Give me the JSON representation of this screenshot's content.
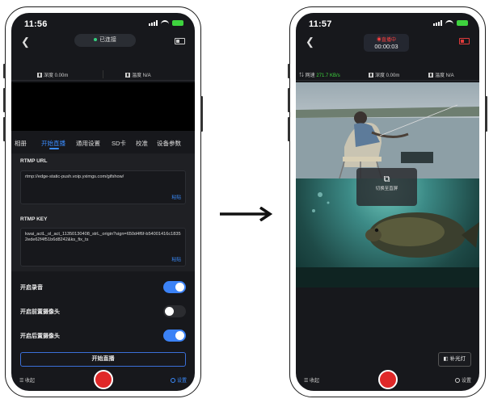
{
  "left_phone": {
    "status": {
      "time": "11:56"
    },
    "nav": {
      "connection": "已连接"
    },
    "sensors": {
      "depth": "深度 0.00m",
      "temp": "温度 N/A"
    },
    "tabs": [
      "相册",
      "开始直播",
      "通用设置",
      "SD卡",
      "校准",
      "设备参数"
    ],
    "rtmp_url": {
      "label": "RTMP URL",
      "value": "rtmp://edge-static-push.voip.yximgs.com/gifshow/",
      "paste": "粘贴"
    },
    "rtmp_key": {
      "label": "RTMP KEY",
      "value": "kwai_actL_ol_act_11350130408_strL_origin?sign=650d4f6f-b54001416c18352ede62f4f51b6d8242&ks_fix_ts",
      "paste": "粘贴"
    },
    "toggles": [
      {
        "label": "开启录音",
        "on": true
      },
      {
        "label": "开启前置摄像头",
        "on": false
      },
      {
        "label": "开启后置摄像头",
        "on": true
      }
    ],
    "start_button": "开始直播",
    "bottom": {
      "collapse": "收起",
      "settings": "设置"
    }
  },
  "right_phone": {
    "status": {
      "time": "11:57"
    },
    "nav": {
      "live_label": "直播中",
      "timer": "00:00:03"
    },
    "sensors": {
      "speed_label": "网速",
      "speed_value": "271.7 KB/s",
      "depth": "深度 0.00m",
      "temp": "温度 N/A"
    },
    "overlay": {
      "label": "切换至直屏"
    },
    "fill_light": "补光灯",
    "bottom": {
      "collapse": "收起",
      "settings": "设置"
    }
  },
  "colors": {
    "accent": "#3b8dff",
    "live_red": "#e02828",
    "toggle_on": "#3b82f6",
    "speed_green": "#3ed33e"
  }
}
